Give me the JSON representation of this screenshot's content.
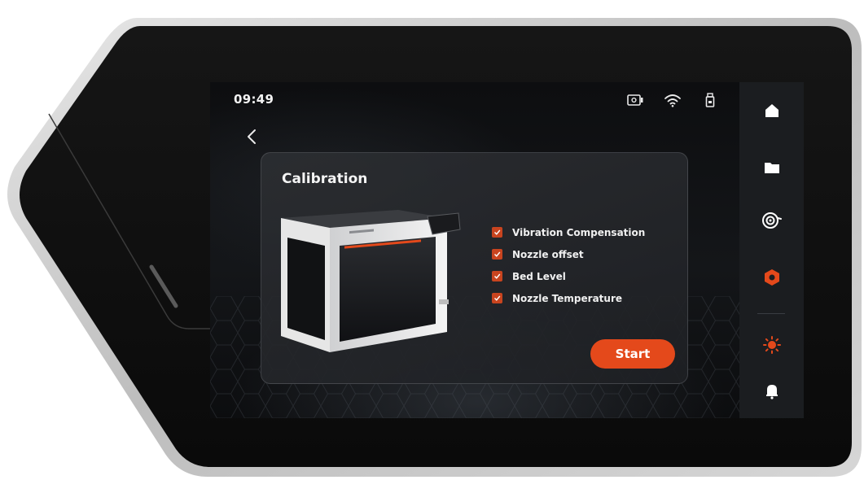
{
  "status_bar": {
    "time": "09:49",
    "icons": [
      "camera-icon",
      "wifi-icon",
      "usb-drive-icon"
    ]
  },
  "header": {
    "back_icon": "chevron-left-icon"
  },
  "card": {
    "title": "Calibration",
    "image": "printer-image",
    "items": [
      {
        "label": "Vibration Compensation",
        "checked": true
      },
      {
        "label": "Nozzle offset",
        "checked": true
      },
      {
        "label": "Bed Level",
        "checked": true
      },
      {
        "label": "Nozzle Temperature",
        "checked": true
      }
    ],
    "start_label": "Start"
  },
  "sidebar": {
    "items": [
      {
        "icon": "home-icon",
        "active": false
      },
      {
        "icon": "folder-icon",
        "active": false
      },
      {
        "icon": "filament-spool-icon",
        "active": false
      },
      {
        "icon": "calibration-hex-icon",
        "active": true
      },
      {
        "icon": "light-icon",
        "active": true
      },
      {
        "icon": "notification-bell-icon",
        "active": false
      }
    ]
  },
  "colors": {
    "accent": "#e4491b",
    "checkbox": "#c8441f",
    "sidebar_bg": "#1b1d20",
    "screen_bg": "#0b0c0e"
  }
}
